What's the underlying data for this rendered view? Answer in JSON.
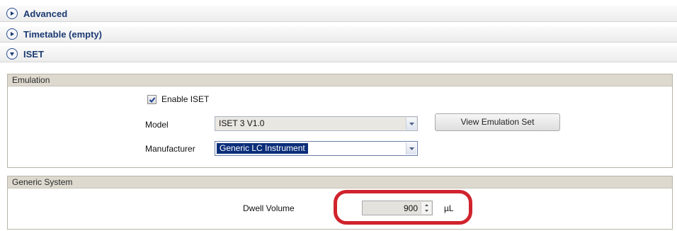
{
  "sections": [
    {
      "label": "Advanced",
      "expanded": false
    },
    {
      "label": "Timetable (empty)",
      "expanded": false
    },
    {
      "label": "ISET",
      "expanded": true
    }
  ],
  "emulation": {
    "title": "Emulation",
    "enable_iset_label": "Enable ISET",
    "enable_iset_checked": true,
    "model_label": "Model",
    "model_value": "ISET 3 V1.0",
    "manufacturer_label": "Manufacturer",
    "manufacturer_value": "Generic LC Instrument",
    "view_emulation_set_label": "View Emulation Set"
  },
  "generic_system": {
    "title": "Generic System",
    "dwell_volume_label": "Dwell Volume",
    "dwell_volume_value": "900",
    "dwell_volume_unit": "µL"
  },
  "colors": {
    "header_text": "#1b3a72",
    "selection": "#0b2e7a",
    "highlight_ring": "#d0232d"
  }
}
